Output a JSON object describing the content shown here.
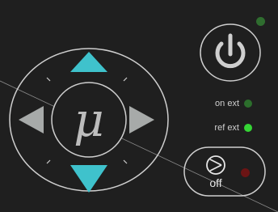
{
  "dpad": {
    "center_glyph": "μ",
    "arrow_up_color": "#3fc2cc",
    "arrow_down_color": "#3fc2cc",
    "arrow_side_color": "#a7aaa9",
    "ring_color": "#cfcfcf"
  },
  "power": {
    "icon": "power-icon",
    "status_led_color": "#2f6d2f"
  },
  "indicators": [
    {
      "label": "on ext",
      "led_color": "#2c6e2c"
    },
    {
      "label": "ref ext",
      "led_color": "#35d535"
    }
  ],
  "pump": {
    "icon": "pump-icon",
    "label": "off",
    "led_color": "#6b1414"
  }
}
